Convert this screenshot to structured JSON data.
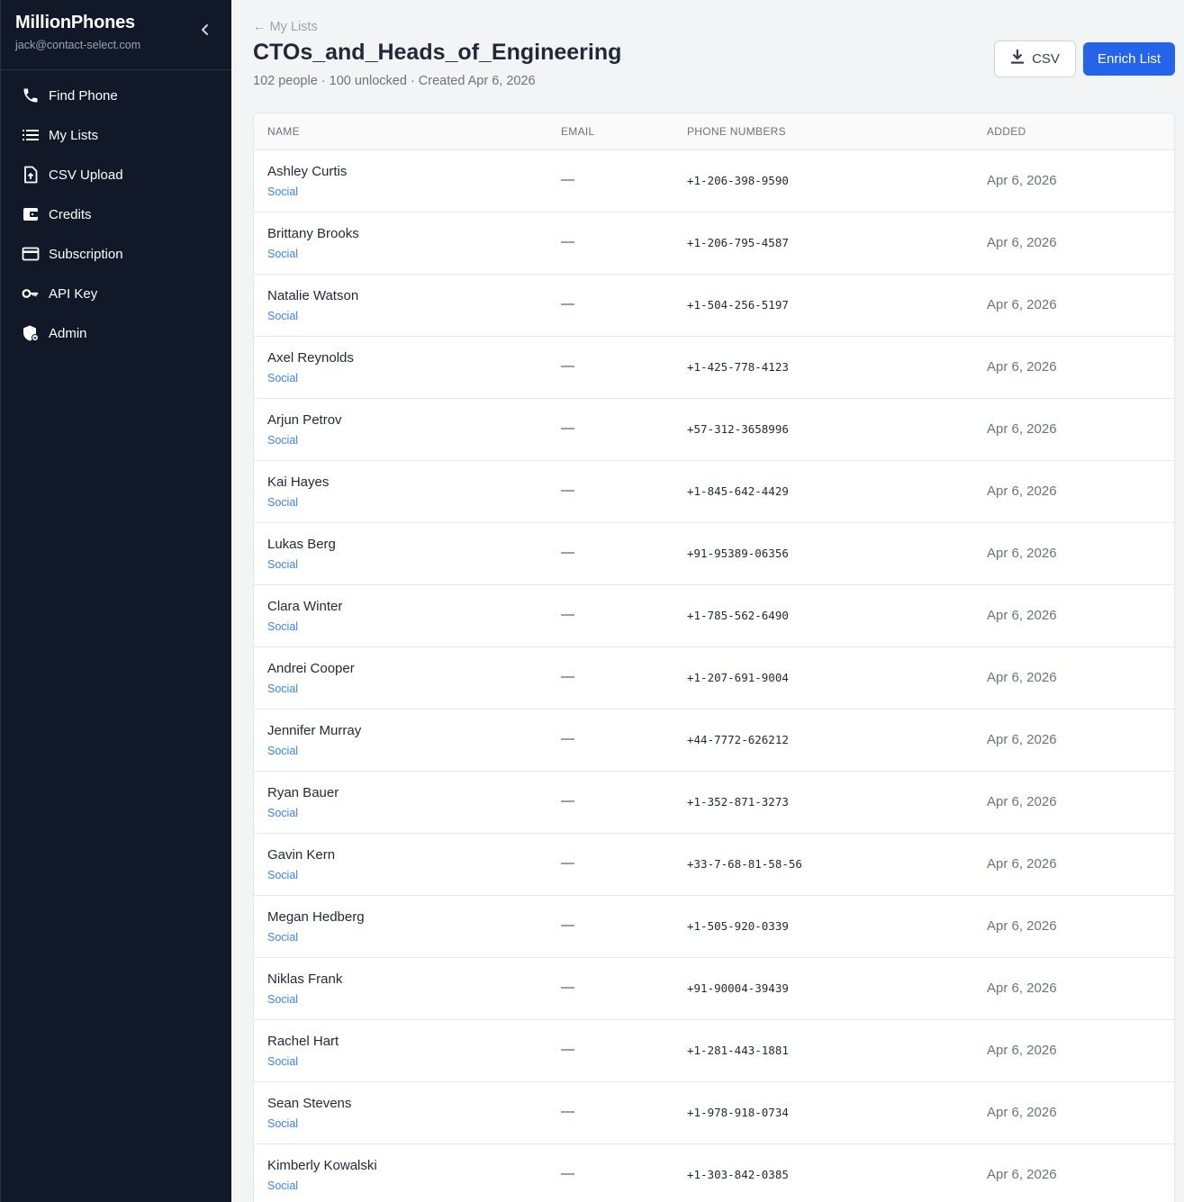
{
  "sidebar": {
    "brand": "MillionPhones",
    "email": "jack@contact-select.com",
    "items": [
      {
        "label": "Find Phone",
        "icon": "phone-icon"
      },
      {
        "label": "My Lists",
        "icon": "list-icon"
      },
      {
        "label": "CSV Upload",
        "icon": "file-upload-icon"
      },
      {
        "label": "Credits",
        "icon": "wallet-icon"
      },
      {
        "label": "Subscription",
        "icon": "credit-card-icon"
      },
      {
        "label": "API Key",
        "icon": "key-icon"
      },
      {
        "label": "Admin",
        "icon": "shield-icon"
      }
    ]
  },
  "header": {
    "back_label": "← My Lists",
    "title": "CTOs_and_Heads_of_Engineering",
    "subtitle": "102 people · 100 unlocked · Created Apr 6, 2026",
    "csv_label": "CSV",
    "enrich_label": "Enrich List"
  },
  "table": {
    "columns": [
      "NAME",
      "EMAIL",
      "PHONE NUMBERS",
      "ADDED"
    ],
    "rows": [
      {
        "name": "Ashley Curtis",
        "source": "Social",
        "email": "—",
        "phone": "+1-206-398-9590",
        "added": "Apr 6, 2026"
      },
      {
        "name": "Brittany Brooks",
        "source": "Social",
        "email": "—",
        "phone": "+1-206-795-4587",
        "added": "Apr 6, 2026"
      },
      {
        "name": "Natalie Watson",
        "source": "Social",
        "email": "—",
        "phone": "+1-504-256-5197",
        "added": "Apr 6, 2026"
      },
      {
        "name": "Axel Reynolds",
        "source": "Social",
        "email": "—",
        "phone": "+1-425-778-4123",
        "added": "Apr 6, 2026"
      },
      {
        "name": "Arjun Petrov",
        "source": "Social",
        "email": "—",
        "phone": "+57-312-3658996",
        "added": "Apr 6, 2026"
      },
      {
        "name": "Kai Hayes",
        "source": "Social",
        "email": "—",
        "phone": "+1-845-642-4429",
        "added": "Apr 6, 2026"
      },
      {
        "name": "Lukas Berg",
        "source": "Social",
        "email": "—",
        "phone": "+91-95389-06356",
        "added": "Apr 6, 2026"
      },
      {
        "name": "Clara Winter",
        "source": "Social",
        "email": "—",
        "phone": "+1-785-562-6490",
        "added": "Apr 6, 2026"
      },
      {
        "name": "Andrei Cooper",
        "source": "Social",
        "email": "—",
        "phone": "+1-207-691-9004",
        "added": "Apr 6, 2026"
      },
      {
        "name": "Jennifer Murray",
        "source": "Social",
        "email": "—",
        "phone": "+44-7772-626212",
        "added": "Apr 6, 2026"
      },
      {
        "name": "Ryan Bauer",
        "source": "Social",
        "email": "—",
        "phone": "+1-352-871-3273",
        "added": "Apr 6, 2026"
      },
      {
        "name": "Gavin Kern",
        "source": "Social",
        "email": "—",
        "phone": "+33-7-68-81-58-56",
        "added": "Apr 6, 2026"
      },
      {
        "name": "Megan Hedberg",
        "source": "Social",
        "email": "—",
        "phone": "+1-505-920-0339",
        "added": "Apr 6, 2026"
      },
      {
        "name": "Niklas Frank",
        "source": "Social",
        "email": "—",
        "phone": "+91-90004-39439",
        "added": "Apr 6, 2026"
      },
      {
        "name": "Rachel Hart",
        "source": "Social",
        "email": "—",
        "phone": "+1-281-443-1881",
        "added": "Apr 6, 2026"
      },
      {
        "name": "Sean Stevens",
        "source": "Social",
        "email": "—",
        "phone": "+1-978-918-0734",
        "added": "Apr 6, 2026"
      },
      {
        "name": "Kimberly Kowalski",
        "source": "Social",
        "email": "—",
        "phone": "+1-303-842-0385",
        "added": "Apr 6, 2026"
      }
    ]
  },
  "colors": {
    "sidebar_bg": "#111827",
    "accent": "#2563eb",
    "link": "#3b82f6",
    "page_bg": "#f3f4f6"
  }
}
